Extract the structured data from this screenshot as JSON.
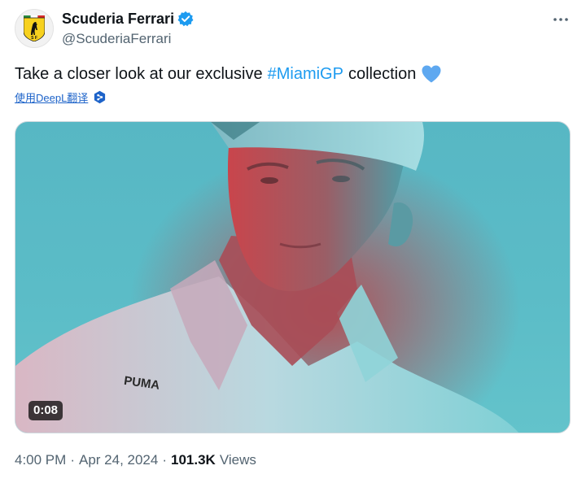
{
  "author": {
    "display_name": "Scuderia Ferrari",
    "handle": "@ScuderiaFerrari",
    "verified": true
  },
  "tweet": {
    "text_before": "Take a closer look at our exclusive",
    "hashtag": "#MiamiGP",
    "text_after": "collection",
    "emoji": "blue-heart",
    "translate_label": "使用DeepL翻译"
  },
  "media": {
    "type": "video",
    "duration": "0:08",
    "shirt_brand": "PUMA"
  },
  "meta": {
    "time": "4:00 PM",
    "separator": "·",
    "date": "Apr 24, 2024",
    "views_count": "101.3K",
    "views_label": "Views"
  },
  "colors": {
    "accent": "#1d9bf0",
    "text_primary": "#0f1419",
    "text_secondary": "#536471",
    "translate_link": "#1d63c9",
    "heart": "#5ea8f0",
    "verified": "#1d9bf0",
    "video_cyan": "#5bbcc7",
    "video_red": "#b14f56"
  },
  "icons": {
    "avatar": "ferrari-shield-logo-icon",
    "verified": "verified-badge-icon",
    "more": "more-options-icon",
    "translate": "deepl-icon"
  }
}
